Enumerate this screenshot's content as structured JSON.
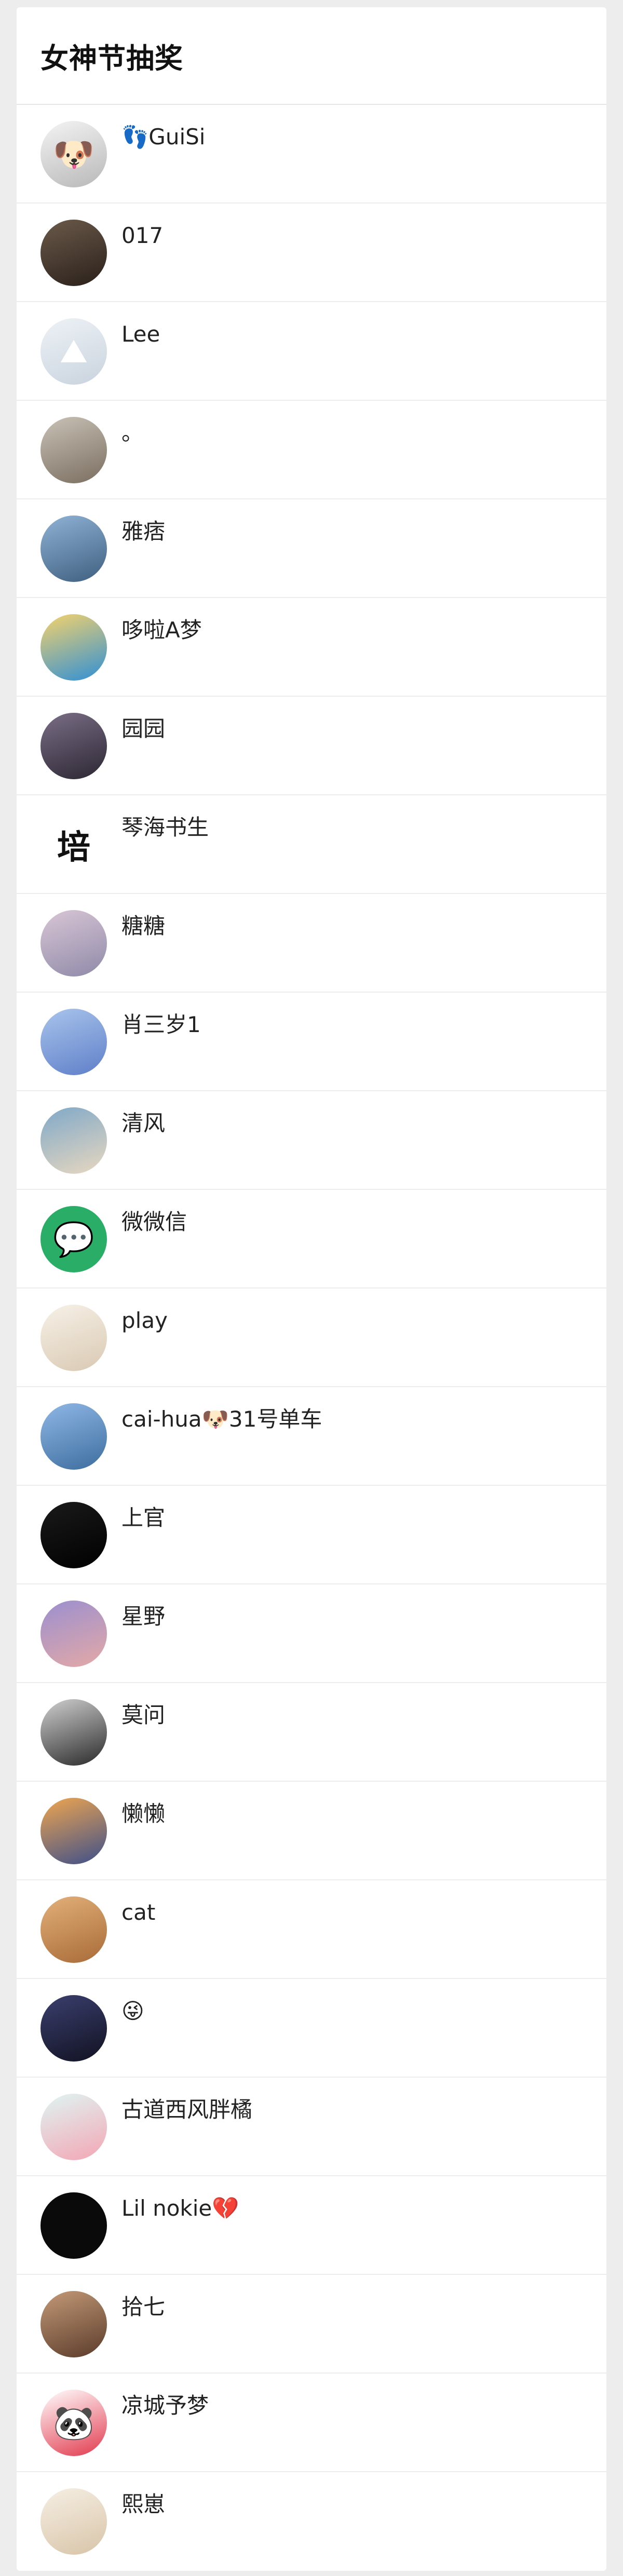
{
  "page": {
    "title": "女神节抽奖"
  },
  "participants": [
    {
      "name": "👣GuiSi",
      "avatar_icon": "cartoon-dog-avatar",
      "avatar_colors": [
        "#f4f4f4",
        "#b8b8b8"
      ],
      "avatar_glyph": "🐶"
    },
    {
      "name": "017",
      "avatar_icon": "photo-avatar",
      "avatar_colors": [
        "#6b5a4a",
        "#2a201a"
      ],
      "avatar_glyph": ""
    },
    {
      "name": "Lee",
      "avatar_icon": "landscape-avatar",
      "avatar_colors": [
        "#eef2f6",
        "#c9d3de"
      ],
      "avatar_glyph": "⛰"
    },
    {
      "name": "。",
      "avatar_icon": "photo-avatar",
      "avatar_colors": [
        "#c9c2b6",
        "#7a6e60"
      ],
      "avatar_glyph": ""
    },
    {
      "name": "雅痞",
      "avatar_icon": "photo-avatar",
      "avatar_colors": [
        "#8fb3d6",
        "#3f5f7f"
      ],
      "avatar_glyph": ""
    },
    {
      "name": "哆啦A梦",
      "avatar_icon": "doraemon-avatar",
      "avatar_colors": [
        "#f6d36b",
        "#2f8fd6"
      ],
      "avatar_glyph": ""
    },
    {
      "name": "园园",
      "avatar_icon": "portrait-avatar",
      "avatar_colors": [
        "#7a6e86",
        "#2c2733"
      ],
      "avatar_glyph": ""
    },
    {
      "name": "琴海书生",
      "avatar_icon": "calligraphy-avatar",
      "avatar_colors": [
        "#ffffff",
        "#ffffff"
      ],
      "avatar_glyph": "培"
    },
    {
      "name": "糖糖",
      "avatar_icon": "portrait-avatar",
      "avatar_colors": [
        "#d9c6d6",
        "#8f8aa8"
      ],
      "avatar_glyph": ""
    },
    {
      "name": "肖三岁1",
      "avatar_icon": "seaside-avatar",
      "avatar_colors": [
        "#a9c4ec",
        "#5f7fc8"
      ],
      "avatar_glyph": ""
    },
    {
      "name": "清风",
      "avatar_icon": "seaside-avatar",
      "avatar_colors": [
        "#7fa8c8",
        "#e8d8c0"
      ],
      "avatar_glyph": ""
    },
    {
      "name": "微微信",
      "avatar_icon": "wechat-avatar",
      "avatar_colors": [
        "#2aae67",
        "#2aae67"
      ],
      "avatar_glyph": "💬"
    },
    {
      "name": "play",
      "avatar_icon": "illustration-avatar",
      "avatar_colors": [
        "#f7f1e8",
        "#d9c9b2"
      ],
      "avatar_glyph": ""
    },
    {
      "name": "cai-hua🐶31号单车",
      "avatar_icon": "cyclist-avatar",
      "avatar_colors": [
        "#8fb7e6",
        "#3d6e9e"
      ],
      "avatar_glyph": ""
    },
    {
      "name": "上官",
      "avatar_icon": "cartoon-avatar",
      "avatar_colors": [
        "#1a1a1a",
        "#000000"
      ],
      "avatar_glyph": ""
    },
    {
      "name": "星野",
      "avatar_icon": "sunset-avatar",
      "avatar_colors": [
        "#9b8fd0",
        "#e4a9a6"
      ],
      "avatar_glyph": ""
    },
    {
      "name": "莫问",
      "avatar_icon": "photo-avatar",
      "avatar_colors": [
        "#d0d0d0",
        "#2a2a2a"
      ],
      "avatar_glyph": ""
    },
    {
      "name": "懒懒",
      "avatar_icon": "sunset-avatar",
      "avatar_colors": [
        "#f0a64f",
        "#3d4f8a"
      ],
      "avatar_glyph": ""
    },
    {
      "name": "cat",
      "avatar_icon": "cat-avatar",
      "avatar_colors": [
        "#e3b07a",
        "#a86b38"
      ],
      "avatar_glyph": ""
    },
    {
      "name": "😜",
      "avatar_icon": "night-avatar",
      "avatar_colors": [
        "#3b3f6e",
        "#111222"
      ],
      "avatar_glyph": ""
    },
    {
      "name": "古道西风胖橘",
      "avatar_icon": "patrick-avatar",
      "avatar_colors": [
        "#dff5f3",
        "#f3a6b4"
      ],
      "avatar_glyph": ""
    },
    {
      "name": "Lil  nokie💔",
      "avatar_icon": "neon-avatar",
      "avatar_colors": [
        "#0a0a0a",
        "#0a0a0a"
      ],
      "avatar_glyph": ""
    },
    {
      "name": "拾七",
      "avatar_icon": "toy-avatar",
      "avatar_colors": [
        "#c49a78",
        "#5a3b2a"
      ],
      "avatar_glyph": ""
    },
    {
      "name": "凉城予梦",
      "avatar_icon": "panda-avatar",
      "avatar_colors": [
        "#ffffff",
        "#e23a4e"
      ],
      "avatar_glyph": "🐼"
    },
    {
      "name": "熙崽",
      "avatar_icon": "illustration-avatar",
      "avatar_colors": [
        "#f6efe4",
        "#d8c4a8"
      ],
      "avatar_glyph": ""
    }
  ]
}
